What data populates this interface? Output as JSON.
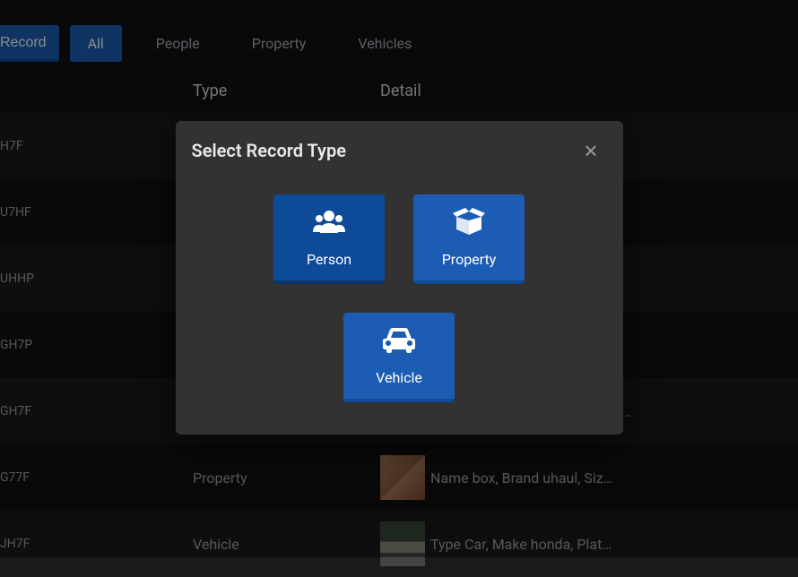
{
  "topbar": {
    "record_button": "Record",
    "tabs": [
      {
        "label": "All",
        "active": true
      },
      {
        "label": "People",
        "active": false
      },
      {
        "label": "Property",
        "active": false
      },
      {
        "label": "Vehicles",
        "active": false
      }
    ]
  },
  "table": {
    "headers": {
      "type": "Type",
      "detail": "Detail"
    },
    "rows": [
      {
        "id": "H7F",
        "type": "",
        "detail": "",
        "thumb": ""
      },
      {
        "id": "U7HF",
        "type": "",
        "detail": "",
        "thumb": ""
      },
      {
        "id": "UHHP",
        "type": "",
        "detail": "",
        "thumb": ""
      },
      {
        "id": "GH7P",
        "type": "",
        "detail": "",
        "thumb": ""
      },
      {
        "id": "GH7F",
        "type": "",
        "detail": "e…",
        "thumb": ""
      },
      {
        "id": "G77F",
        "type": "Property",
        "detail": "Name box, Brand uhaul, Size…",
        "thumb": "box"
      },
      {
        "id": "JH7F",
        "type": "Vehicle",
        "detail": "Type Car, Make honda, Plate…",
        "thumb": "car"
      }
    ]
  },
  "modal": {
    "title": "Select Record Type",
    "options": [
      {
        "key": "person",
        "label": "Person",
        "icon": "users-icon"
      },
      {
        "key": "property",
        "label": "Property",
        "icon": "box-open-icon"
      },
      {
        "key": "vehicle",
        "label": "Vehicle",
        "icon": "car-icon"
      }
    ],
    "close_glyph": "×"
  }
}
